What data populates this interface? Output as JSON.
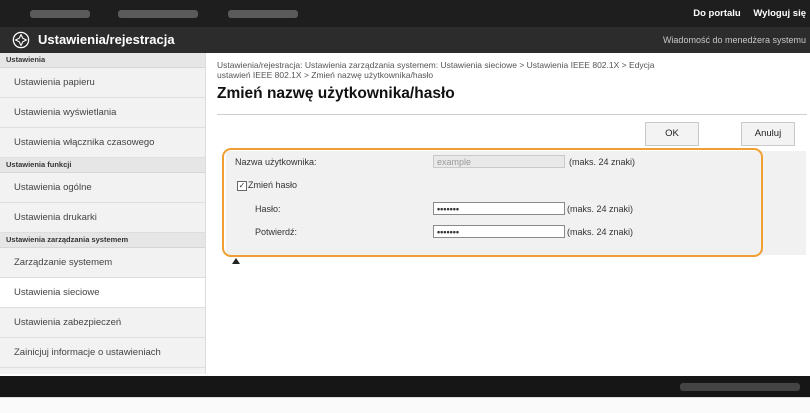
{
  "top": {
    "portal_link": "Do portalu",
    "logout_link": "Wyloguj się"
  },
  "header": {
    "title": "Ustawienia/rejestracja",
    "admin_message": "Wiadomość do menedżera systemu"
  },
  "sidebar": {
    "section_settings": "Ustawienia",
    "paper_settings": "Ustawienia papieru",
    "display_settings": "Ustawienia wyświetlania",
    "timer_settings": "Ustawienia włącznika czasowego",
    "section_function": "Ustawienia funkcji",
    "general_settings": "Ustawienia ogólne",
    "printer_settings": "Ustawienia drukarki",
    "section_system": "Ustawienia zarządzania systemem",
    "system_management": "Zarządzanie systemem",
    "network_settings": "Ustawienia sieciowe",
    "security_settings": "Ustawienia zabezpieczeń",
    "settings_info": "Zainicjuj informacje o ustawieniach"
  },
  "main": {
    "breadcrumb_line1": "Ustawienia/rejestracja: Ustawienia zarządzania systemem: Ustawienia sieciowe > Ustawienia IEEE 802.1X > Edycja",
    "breadcrumb_line2": "ustawień IEEE 802.1X > Zmień nazwę użytkownika/hasło",
    "page_title": "Zmień nazwę użytkownika/hasło",
    "ok_button": "OK",
    "cancel_button": "Anuluj"
  },
  "form": {
    "username_label": "Nazwa użytkownika:",
    "username_value": "example",
    "username_hint": "(maks. 24 znaki)",
    "change_password_label": "Zmień hasło",
    "change_password_checked": true,
    "password_label": "Hasło:",
    "password_value": "•••••••",
    "password_hint": "(maks. 24 znaki)",
    "confirm_label": "Potwierdź:",
    "confirm_value": "•••••••",
    "confirm_hint": "(maks. 24 znaki)"
  },
  "colors": {
    "highlight": "#f0a032",
    "topbar": "#1e1e1e",
    "titlebar": "#2c2c2c"
  }
}
